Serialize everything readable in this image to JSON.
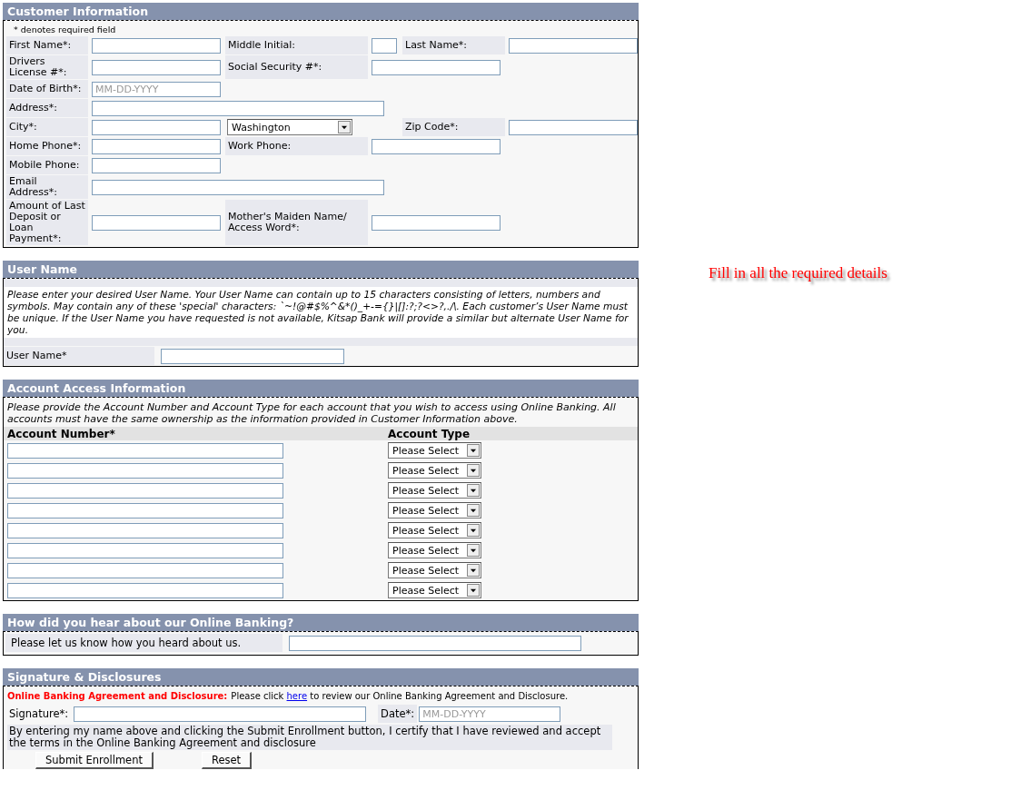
{
  "customer": {
    "title": "Customer Information",
    "note": "* denotes required field",
    "rows": [
      {
        "fields": [
          {
            "label": "First Name*:",
            "kind": "text"
          },
          {
            "label": "Middle Initial:",
            "kind": "short"
          },
          {
            "label": "Last Name*:",
            "kind": "text"
          }
        ]
      },
      {
        "fields": [
          {
            "label": "Drivers License #*:",
            "kind": "text"
          },
          {
            "label": "Social Security #*:",
            "kind": "text"
          }
        ]
      },
      {
        "fields": [
          {
            "label": "Date of Birth*:",
            "kind": "text",
            "placeholder": "MM-DD-YYYY"
          }
        ]
      },
      {
        "fields": [
          {
            "label": "Address*:",
            "kind": "wide"
          }
        ]
      },
      {
        "fields": [
          {
            "label": "City*:",
            "kind": "text"
          },
          {
            "kind": "select",
            "value": "Washington"
          },
          {
            "label": "Zip Code*:",
            "kind": "text"
          }
        ]
      },
      {
        "fields": [
          {
            "label": "Home Phone*:",
            "kind": "text"
          },
          {
            "label": "Work Phone:",
            "kind": "text"
          }
        ]
      },
      {
        "fields": [
          {
            "label": "Mobile Phone:",
            "kind": "text"
          }
        ]
      },
      {
        "fields": [
          {
            "label": "Email Address*:",
            "kind": "wide"
          }
        ]
      },
      {
        "fields": [
          {
            "label": "Amount of Last Deposit or Loan Payment*:",
            "kind": "text"
          },
          {
            "label": "Mother's Maiden Name/ Access Word*:",
            "kind": "text"
          }
        ]
      }
    ]
  },
  "username": {
    "title": "User Name",
    "instructions": "Please enter your desired User Name. Your User Name can contain up to 15 characters consisting of letters, numbers and symbols. May contain any of these 'special' characters: `~!@#$%^&*()_+-={}|[]:?;?<>?,./\\. Each customer’s User Name must be unique. If the User Name you have requested is not available, Kitsap Bank will provide a similar but alternate User Name for you.",
    "label": "User Name*"
  },
  "accounts": {
    "title": "Account Access Information",
    "instructions": "Please provide the Account Number and Account Type for each account that you wish to access using Online Banking. All accounts must have the same ownership as the information provided in Customer Information above.",
    "columns": [
      "Account Number*",
      "Account Type"
    ],
    "rows": [
      {
        "type": "Please Select"
      },
      {
        "type": "Please Select"
      },
      {
        "type": "Please Select"
      },
      {
        "type": "Please Select"
      },
      {
        "type": "Please Select"
      },
      {
        "type": "Please Select"
      },
      {
        "type": "Please Select"
      },
      {
        "type": "Please Select"
      }
    ]
  },
  "referral": {
    "title": "How did you hear about our Online Banking?",
    "label": "Please let us know how you heard about us."
  },
  "signature": {
    "title": "Signature & Disclosures",
    "disclosure_title": "Online Banking Agreement and Disclosure:",
    "disclosure_before": "Please click",
    "disclosure_link": "here",
    "disclosure_after": "to review our Online Banking Agreement and Disclosure.",
    "signature_label": "Signature*:",
    "date_label": "Date*:",
    "date_placeholder": "MM-DD-YYYY",
    "certification": "By entering my name above and clicking the Submit Enrollment button, I certify that I have reviewed and accept the terms in the Online Banking Agreement and disclosure",
    "buttons": [
      "Submit Enrollment",
      "Reset"
    ]
  },
  "message": "Fill in all the required details"
}
